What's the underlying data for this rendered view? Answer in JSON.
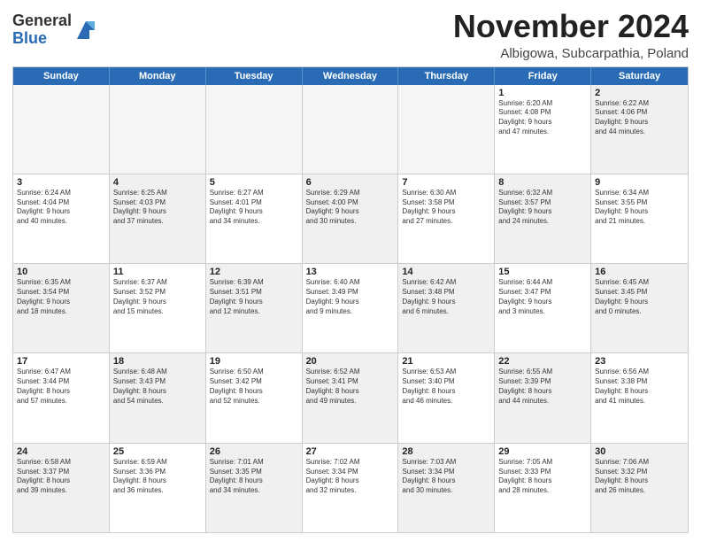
{
  "header": {
    "logo_general": "General",
    "logo_blue": "Blue",
    "month_title": "November 2024",
    "subtitle": "Albigowa, Subcarpathia, Poland"
  },
  "weekdays": [
    "Sunday",
    "Monday",
    "Tuesday",
    "Wednesday",
    "Thursday",
    "Friday",
    "Saturday"
  ],
  "rows": [
    [
      {
        "day": "",
        "text": "",
        "empty": true
      },
      {
        "day": "",
        "text": "",
        "empty": true
      },
      {
        "day": "",
        "text": "",
        "empty": true
      },
      {
        "day": "",
        "text": "",
        "empty": true
      },
      {
        "day": "",
        "text": "",
        "empty": true
      },
      {
        "day": "1",
        "text": "Sunrise: 6:20 AM\nSunset: 4:08 PM\nDaylight: 9 hours\nand 47 minutes.",
        "empty": false,
        "shaded": false
      },
      {
        "day": "2",
        "text": "Sunrise: 6:22 AM\nSunset: 4:06 PM\nDaylight: 9 hours\nand 44 minutes.",
        "empty": false,
        "shaded": true
      }
    ],
    [
      {
        "day": "3",
        "text": "Sunrise: 6:24 AM\nSunset: 4:04 PM\nDaylight: 9 hours\nand 40 minutes.",
        "empty": false,
        "shaded": false
      },
      {
        "day": "4",
        "text": "Sunrise: 6:25 AM\nSunset: 4:03 PM\nDaylight: 9 hours\nand 37 minutes.",
        "empty": false,
        "shaded": true
      },
      {
        "day": "5",
        "text": "Sunrise: 6:27 AM\nSunset: 4:01 PM\nDaylight: 9 hours\nand 34 minutes.",
        "empty": false,
        "shaded": false
      },
      {
        "day": "6",
        "text": "Sunrise: 6:29 AM\nSunset: 4:00 PM\nDaylight: 9 hours\nand 30 minutes.",
        "empty": false,
        "shaded": true
      },
      {
        "day": "7",
        "text": "Sunrise: 6:30 AM\nSunset: 3:58 PM\nDaylight: 9 hours\nand 27 minutes.",
        "empty": false,
        "shaded": false
      },
      {
        "day": "8",
        "text": "Sunrise: 6:32 AM\nSunset: 3:57 PM\nDaylight: 9 hours\nand 24 minutes.",
        "empty": false,
        "shaded": true
      },
      {
        "day": "9",
        "text": "Sunrise: 6:34 AM\nSunset: 3:55 PM\nDaylight: 9 hours\nand 21 minutes.",
        "empty": false,
        "shaded": false
      }
    ],
    [
      {
        "day": "10",
        "text": "Sunrise: 6:35 AM\nSunset: 3:54 PM\nDaylight: 9 hours\nand 18 minutes.",
        "empty": false,
        "shaded": true
      },
      {
        "day": "11",
        "text": "Sunrise: 6:37 AM\nSunset: 3:52 PM\nDaylight: 9 hours\nand 15 minutes.",
        "empty": false,
        "shaded": false
      },
      {
        "day": "12",
        "text": "Sunrise: 6:39 AM\nSunset: 3:51 PM\nDaylight: 9 hours\nand 12 minutes.",
        "empty": false,
        "shaded": true
      },
      {
        "day": "13",
        "text": "Sunrise: 6:40 AM\nSunset: 3:49 PM\nDaylight: 9 hours\nand 9 minutes.",
        "empty": false,
        "shaded": false
      },
      {
        "day": "14",
        "text": "Sunrise: 6:42 AM\nSunset: 3:48 PM\nDaylight: 9 hours\nand 6 minutes.",
        "empty": false,
        "shaded": true
      },
      {
        "day": "15",
        "text": "Sunrise: 6:44 AM\nSunset: 3:47 PM\nDaylight: 9 hours\nand 3 minutes.",
        "empty": false,
        "shaded": false
      },
      {
        "day": "16",
        "text": "Sunrise: 6:45 AM\nSunset: 3:45 PM\nDaylight: 9 hours\nand 0 minutes.",
        "empty": false,
        "shaded": true
      }
    ],
    [
      {
        "day": "17",
        "text": "Sunrise: 6:47 AM\nSunset: 3:44 PM\nDaylight: 8 hours\nand 57 minutes.",
        "empty": false,
        "shaded": false
      },
      {
        "day": "18",
        "text": "Sunrise: 6:48 AM\nSunset: 3:43 PM\nDaylight: 8 hours\nand 54 minutes.",
        "empty": false,
        "shaded": true
      },
      {
        "day": "19",
        "text": "Sunrise: 6:50 AM\nSunset: 3:42 PM\nDaylight: 8 hours\nand 52 minutes.",
        "empty": false,
        "shaded": false
      },
      {
        "day": "20",
        "text": "Sunrise: 6:52 AM\nSunset: 3:41 PM\nDaylight: 8 hours\nand 49 minutes.",
        "empty": false,
        "shaded": true
      },
      {
        "day": "21",
        "text": "Sunrise: 6:53 AM\nSunset: 3:40 PM\nDaylight: 8 hours\nand 46 minutes.",
        "empty": false,
        "shaded": false
      },
      {
        "day": "22",
        "text": "Sunrise: 6:55 AM\nSunset: 3:39 PM\nDaylight: 8 hours\nand 44 minutes.",
        "empty": false,
        "shaded": true
      },
      {
        "day": "23",
        "text": "Sunrise: 6:56 AM\nSunset: 3:38 PM\nDaylight: 8 hours\nand 41 minutes.",
        "empty": false,
        "shaded": false
      }
    ],
    [
      {
        "day": "24",
        "text": "Sunrise: 6:58 AM\nSunset: 3:37 PM\nDaylight: 8 hours\nand 39 minutes.",
        "empty": false,
        "shaded": true
      },
      {
        "day": "25",
        "text": "Sunrise: 6:59 AM\nSunset: 3:36 PM\nDaylight: 8 hours\nand 36 minutes.",
        "empty": false,
        "shaded": false
      },
      {
        "day": "26",
        "text": "Sunrise: 7:01 AM\nSunset: 3:35 PM\nDaylight: 8 hours\nand 34 minutes.",
        "empty": false,
        "shaded": true
      },
      {
        "day": "27",
        "text": "Sunrise: 7:02 AM\nSunset: 3:34 PM\nDaylight: 8 hours\nand 32 minutes.",
        "empty": false,
        "shaded": false
      },
      {
        "day": "28",
        "text": "Sunrise: 7:03 AM\nSunset: 3:34 PM\nDaylight: 8 hours\nand 30 minutes.",
        "empty": false,
        "shaded": true
      },
      {
        "day": "29",
        "text": "Sunrise: 7:05 AM\nSunset: 3:33 PM\nDaylight: 8 hours\nand 28 minutes.",
        "empty": false,
        "shaded": false
      },
      {
        "day": "30",
        "text": "Sunrise: 7:06 AM\nSunset: 3:32 PM\nDaylight: 8 hours\nand 26 minutes.",
        "empty": false,
        "shaded": true
      }
    ]
  ]
}
